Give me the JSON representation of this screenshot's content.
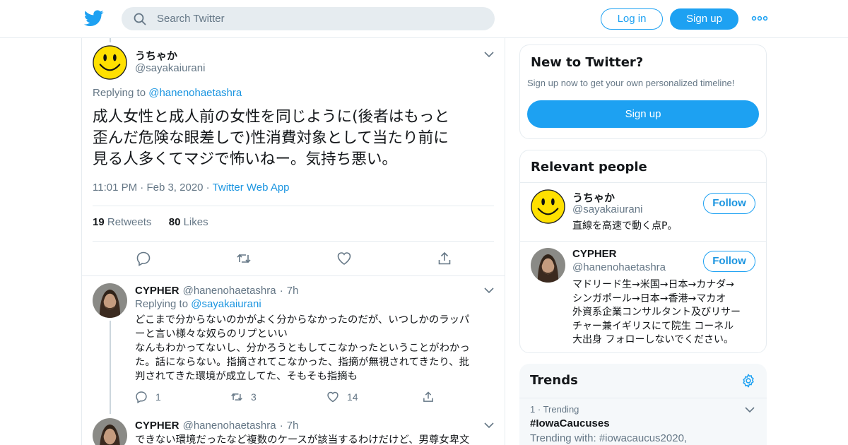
{
  "header": {
    "search_placeholder": "Search Twitter",
    "login_label": "Log in",
    "signup_label": "Sign up"
  },
  "tweet": {
    "author_name": "うちゃか",
    "author_handle": "@sayakaiurani",
    "replying_prefix": "Replying to ",
    "replying_to": "@hanenohaetashra",
    "text_lines": [
      "成人女性と成人前の女性を同じように(後者はもっと",
      "歪んだ危険な眼差しで)性消費対象として当たり前に",
      "見る人多くてマジで怖いねー。気持ち悪い。"
    ],
    "time": "11:01 PM",
    "date": "Feb 3, 2020",
    "source": "Twitter Web App",
    "retweets_count": "19",
    "retweets_label": "Retweets",
    "likes_count": "80",
    "likes_label": "Likes"
  },
  "replies": [
    {
      "author_name": "CYPHER",
      "author_handle": "@hanenohaetashra",
      "age": "7h",
      "replying_prefix": "Replying to ",
      "replying_to": "@sayakaiurani",
      "text_lines": [
        "どこまで分からないのかがよく分からなかったのだが、いつしかのラッパ",
        "ーと言い様々な奴らのリプといい",
        "なんもわかってないし、分かろうともしてこなかったということがわかっ",
        "た。話にならない。指摘されてこなかった、指摘が無視されてきたり、批",
        "判されてきた環境が成立してた、そもそも指摘も"
      ],
      "reply_count": "1",
      "retweet_count": "3",
      "like_count": "14"
    },
    {
      "author_name": "CYPHER",
      "author_handle": "@hanenohaetashra",
      "age": "7h",
      "text_lines": [
        "できない環境だったなど複数のケースが該当するわけだけど、男尊女卑文"
      ]
    }
  ],
  "sidebar": {
    "new_title": "New to Twitter?",
    "new_subtitle": "Sign up now to get your own personalized timeline!",
    "new_signup": "Sign up",
    "relevant_title": "Relevant people",
    "people": [
      {
        "name": "うちゃか",
        "handle": "@sayakaiurani",
        "follow_label": "Follow",
        "bio_lines": [
          "直線を高速で動く点P。"
        ]
      },
      {
        "name": "CYPHER",
        "handle": "@hanenohaetashra",
        "follow_label": "Follow",
        "bio_lines": [
          "マドリード生→米国→日本→カナダ→",
          "シンガポール→日本→香港→マカオ",
          "外資系企業コンサルタント及びリサー",
          "チャー兼イギリスにて院生 コーネル",
          "大出身 フォローしないでください。"
        ]
      }
    ],
    "trends_title": "Trends",
    "trends": [
      {
        "rank": "1",
        "label": "Trending",
        "name": "#IowaCaucuses",
        "with": "Trending with: #iowacaucus2020,"
      }
    ]
  },
  "colors": {
    "brand": "#1da1f2",
    "link": "#1b95e0",
    "muted": "#657786",
    "border": "#e6ecf0"
  },
  "icons": [
    "twitter-logo-icon",
    "search-icon",
    "more-icon",
    "chevron-down-icon",
    "reply-icon",
    "retweet-icon",
    "like-icon",
    "share-icon",
    "settings-icon"
  ]
}
